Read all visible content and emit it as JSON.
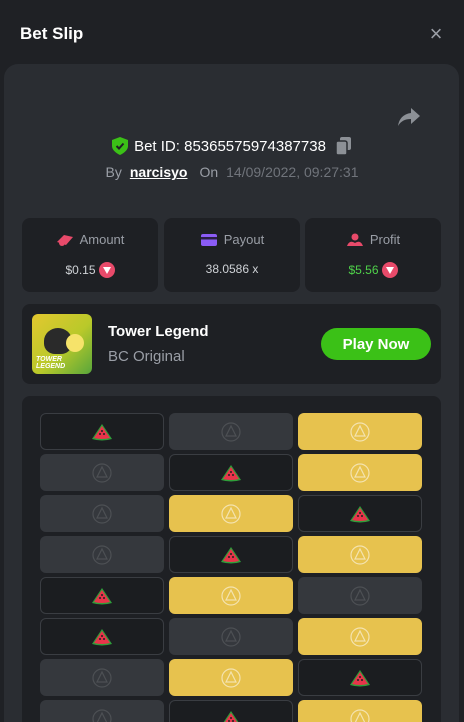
{
  "header": {
    "title": "Bet Slip",
    "close_label": "×"
  },
  "bet": {
    "id_text": "Bet ID: 85365575974387738",
    "by_label": "By",
    "username": "narcisyo",
    "on_label": "On",
    "datetime": "14/09/2022, 09:27:31"
  },
  "stats": {
    "amount_label": "Amount",
    "amount_value": "$0.15",
    "payout_label": "Payout",
    "payout_value": "38.0586 x",
    "profit_label": "Profit",
    "profit_value": "$5.56"
  },
  "game": {
    "name": "Tower Legend",
    "subtitle": "BC Original",
    "play_label": "Play Now",
    "thumb_text": "TOWER LEGEND"
  },
  "board": {
    "rows": [
      [
        "watermelon-plain",
        "gray",
        "yellow"
      ],
      [
        "gray",
        "watermelon-plain",
        "yellow"
      ],
      [
        "gray",
        "yellow",
        "watermelon-plain"
      ],
      [
        "gray",
        "watermelon-plain",
        "yellow"
      ],
      [
        "watermelon-plain",
        "yellow",
        "gray"
      ],
      [
        "watermelon-plain",
        "gray",
        "yellow"
      ],
      [
        "gray",
        "yellow",
        "watermelon-plain"
      ],
      [
        "gray",
        "watermelon-plain",
        "yellow"
      ]
    ]
  },
  "colors": {
    "accent_green": "#3bc117",
    "tile_gold": "#e7c24e",
    "profit_green": "#4fd14a"
  }
}
